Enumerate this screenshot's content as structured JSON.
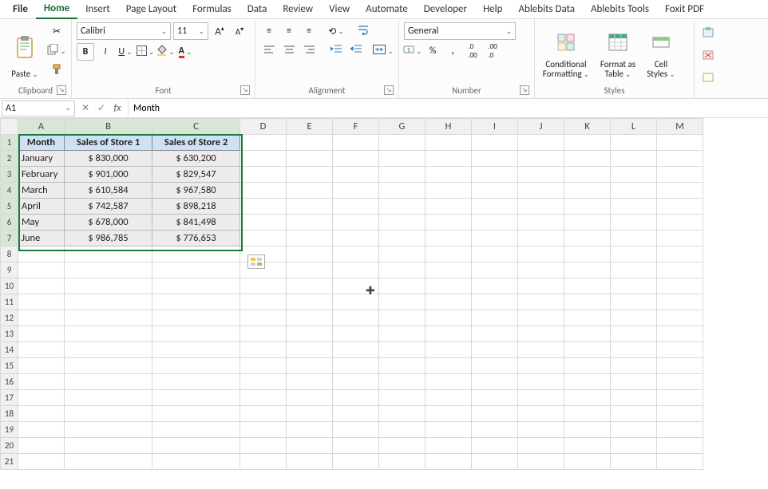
{
  "tabs": [
    "File",
    "Home",
    "Insert",
    "Page Layout",
    "Formulas",
    "Data",
    "Review",
    "View",
    "Automate",
    "Developer",
    "Help",
    "Ablebits Data",
    "Ablebits Tools",
    "Foxit PDF"
  ],
  "active_tab": "Home",
  "ribbon": {
    "clipboard": {
      "paste": "Paste",
      "label": "Clipboard"
    },
    "font": {
      "name": "Calibri",
      "size": "11",
      "label": "Font"
    },
    "alignment": {
      "label": "Alignment"
    },
    "number": {
      "format": "General",
      "label": "Number"
    },
    "styles": {
      "cond": "Conditional Formatting",
      "table": "Format as Table",
      "cell": "Cell Styles",
      "label": "Styles"
    }
  },
  "namebox": "A1",
  "formula": "Month",
  "columns": [
    "A",
    "B",
    "C",
    "D",
    "E",
    "F",
    "G",
    "H",
    "I",
    "J",
    "K",
    "L",
    "M"
  ],
  "sel_cols": [
    "A",
    "B",
    "C"
  ],
  "sel_rows": [
    1,
    2,
    3,
    4,
    5,
    6,
    7
  ],
  "chart_data": {
    "type": "table",
    "headers": [
      "Month",
      "Sales of Store 1",
      "Sales of Store 2"
    ],
    "rows": [
      [
        "January",
        "$ 830,000",
        "$ 630,200"
      ],
      [
        "February",
        "$ 901,000",
        "$ 829,547"
      ],
      [
        "March",
        "$ 610,584",
        "$ 967,580"
      ],
      [
        "April",
        "$ 742,587",
        "$ 898,218"
      ],
      [
        "May",
        "$ 678,000",
        "$ 841,498"
      ],
      [
        "June",
        "$ 986,785",
        "$ 776,653"
      ]
    ]
  },
  "total_rows": 21
}
